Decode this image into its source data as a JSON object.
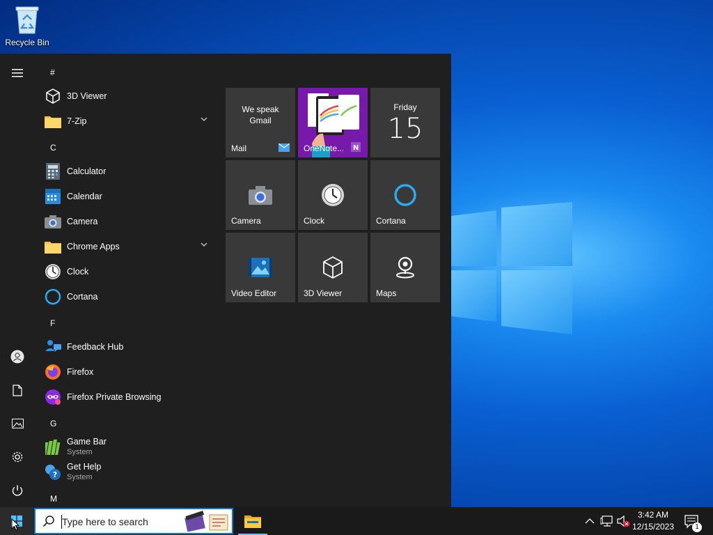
{
  "desktop": {
    "recycle_bin_label": "Recycle Bin"
  },
  "start_menu": {
    "rail": {
      "items": [
        "menu-icon",
        "user-icon",
        "documents-icon",
        "pictures-icon",
        "settings-icon",
        "power-icon"
      ]
    },
    "groups": {
      "hash": "#",
      "c": "C",
      "f": "F",
      "g": "G",
      "m": "M"
    },
    "apps": {
      "viewer3d": "3D Viewer",
      "zip7": "7-Zip",
      "calculator": "Calculator",
      "calendar": "Calendar",
      "camera": "Camera",
      "chrome_apps": "Chrome Apps",
      "clock": "Clock",
      "cortana": "Cortana",
      "feedback_hub": "Feedback Hub",
      "firefox": "Firefox",
      "firefox_private": "Firefox Private Browsing",
      "game_bar": "Game Bar",
      "game_bar_sub": "System",
      "get_help": "Get Help",
      "get_help_sub": "System"
    },
    "tiles": {
      "mail_headline": "We speak\nGmail",
      "mail": "Mail",
      "onenote": "OneNote...",
      "calendar_day": "Friday",
      "calendar_date": "15",
      "camera": "Camera",
      "clock": "Clock",
      "cortana": "Cortana",
      "video_editor": "Video Editor",
      "viewer3d": "3D Viewer",
      "maps": "Maps"
    }
  },
  "taskbar": {
    "search_placeholder": "Type here to search",
    "time": "3:42 AM",
    "date": "12/15/2023",
    "notification_count": "1"
  },
  "colors": {
    "accent": "#0078d7",
    "start_bg": "#1f1f1f",
    "tile_bg": "#393939",
    "onenote_tile": "#7719aa"
  }
}
